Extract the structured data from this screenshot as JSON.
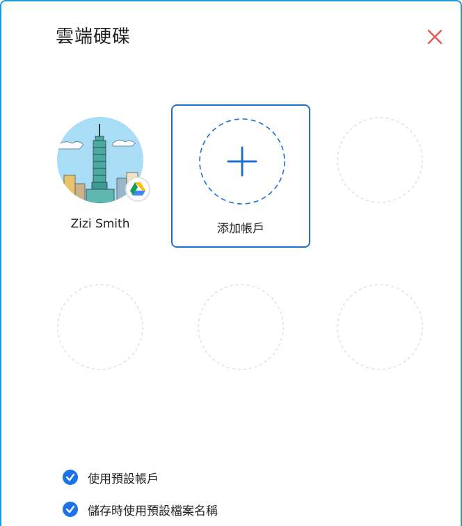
{
  "dialog": {
    "title": "雲端硬碟",
    "close_icon": "close-icon",
    "accent_color": "#1a9bd8",
    "close_color": "#e8594a"
  },
  "accounts": [
    {
      "name": "Zizi Smith",
      "avatar": "taipei-101-avatar",
      "badge_icon": "google-drive-icon"
    }
  ],
  "add_account": {
    "label": "添加帳戶",
    "icon": "plus-icon"
  },
  "options": [
    {
      "label": "使用預設帳戶",
      "checked": true
    },
    {
      "label": "儲存時使用預設檔案名稱",
      "checked": true
    }
  ]
}
